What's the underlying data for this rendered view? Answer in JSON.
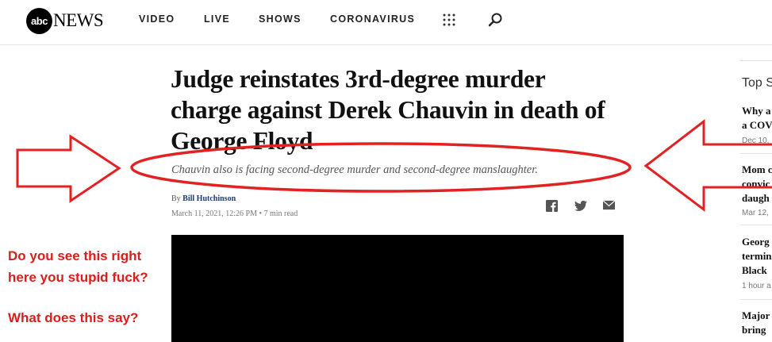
{
  "header": {
    "logo_badge": "abc",
    "logo_text": "NEWS",
    "nav": [
      "VIDEO",
      "LIVE",
      "SHOWS",
      "CORONAVIRUS"
    ]
  },
  "article": {
    "headline": "Judge reinstates 3rd-degree murder charge against Derek Chauvin in death of George Floyd",
    "subhead": "Chauvin also is facing second-degree murder and second-degree manslaughter.",
    "byline_prefix": "By",
    "author": "Bill Hutchinson",
    "date": "March 11, 2021, 12:26 PM",
    "read_time": "• 7 min read"
  },
  "sidebar": {
    "heading": "Top S",
    "items": [
      {
        "lines": [
          "Why a",
          "a COV"
        ],
        "meta": "Dec 10,"
      },
      {
        "lines": [
          "Mom c",
          "convic",
          "daugh"
        ],
        "meta": "Mar 12,"
      },
      {
        "lines": [
          "Georg",
          "termin",
          "Black"
        ],
        "meta": "1 hour a"
      },
      {
        "lines": [
          "Major",
          "bring"
        ],
        "meta": ""
      }
    ]
  },
  "annotation": {
    "line1": "Do you see this right",
    "line2": "here you stupid fuck?",
    "line3": "What does this say?"
  },
  "colors": {
    "annotation_red": "#dd1c1c",
    "author_link": "#1d3b6f"
  },
  "icons": [
    "grid-icon",
    "search-icon",
    "facebook-icon",
    "twitter-icon",
    "email-icon"
  ]
}
